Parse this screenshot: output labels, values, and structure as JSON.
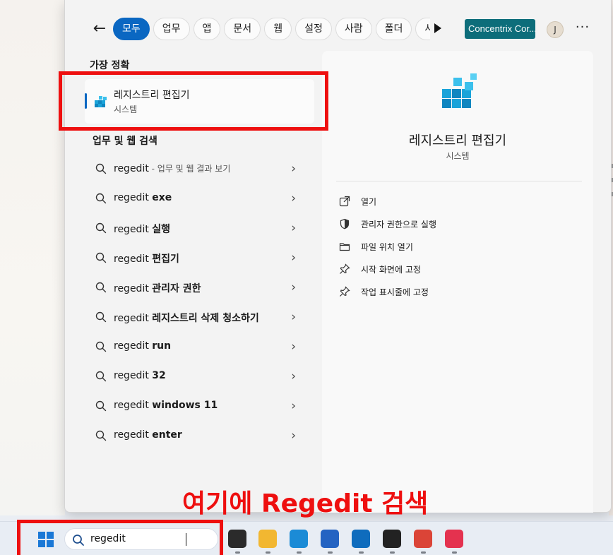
{
  "filters": {
    "back_glyph": "←",
    "chips": [
      {
        "label": "모두",
        "active": true
      },
      {
        "label": "업무",
        "active": false
      },
      {
        "label": "앱",
        "active": false
      },
      {
        "label": "문서",
        "active": false
      },
      {
        "label": "웹",
        "active": false
      },
      {
        "label": "설정",
        "active": false
      },
      {
        "label": "사람",
        "active": false
      },
      {
        "label": "폴더",
        "active": false
      },
      {
        "label": "사",
        "active": false
      }
    ],
    "org_label": "Concentrix Cor...",
    "avatar_initial": "J",
    "more_glyph": "···"
  },
  "best_match": {
    "section_title": "가장 정확",
    "name": "레지스트리 편집기",
    "type": "시스템",
    "icon": "registry-editor-icon"
  },
  "web_search": {
    "section_title": "업무 및 웹 검색",
    "results": [
      {
        "prefix": "regedit",
        "bold": "",
        "note": " - 업무 및 웹 결과 보기"
      },
      {
        "prefix": "regedit ",
        "bold": "exe",
        "note": ""
      },
      {
        "prefix": "regedit ",
        "bold": "실행",
        "note": ""
      },
      {
        "prefix": "regedit ",
        "bold": "편집기",
        "note": ""
      },
      {
        "prefix": "regedit ",
        "bold": "관리자 권한",
        "note": ""
      },
      {
        "prefix": "regedit ",
        "bold": "레지스트리 삭제 청소하기",
        "note": ""
      },
      {
        "prefix": "regedit ",
        "bold": "run",
        "note": ""
      },
      {
        "prefix": "regedit ",
        "bold": "32",
        "note": ""
      },
      {
        "prefix": "regedit ",
        "bold": "windows 11",
        "note": ""
      },
      {
        "prefix": "regedit ",
        "bold": "enter",
        "note": ""
      }
    ],
    "chevron": "›"
  },
  "detail": {
    "name": "레지스트리 편집기",
    "type": "시스템",
    "actions": [
      {
        "label": "열기",
        "icon": "open-icon"
      },
      {
        "label": "관리자 권한으로 실행",
        "icon": "shield-icon"
      },
      {
        "label": "파일 위치 열기",
        "icon": "folder-icon"
      },
      {
        "label": "시작 화면에 고정",
        "icon": "pin-icon"
      },
      {
        "label": "작업 표시줄에 고정",
        "icon": "pin-icon"
      }
    ]
  },
  "annotation": {
    "text": "여기에 Regedit 검색",
    "color": "#ee0f0f"
  },
  "taskbar": {
    "search_value": "regedit",
    "apps": [
      {
        "name": "task-view-icon",
        "color": "#2b2b2b"
      },
      {
        "name": "file-explorer-icon",
        "color": "#f2b731"
      },
      {
        "name": "edge-icon",
        "color": "#1b8bd6"
      },
      {
        "name": "store-icon",
        "color": "#2463c2"
      },
      {
        "name": "outlook-icon",
        "color": "#0f6cbd"
      },
      {
        "name": "headset-icon",
        "color": "#222222"
      },
      {
        "name": "chrome-icon",
        "color": "#db4437"
      },
      {
        "name": "creative-cloud-icon",
        "color": "#e4324f"
      }
    ]
  },
  "colors": {
    "accent": "#0a67c2",
    "highlight": "#ee0f0f"
  }
}
